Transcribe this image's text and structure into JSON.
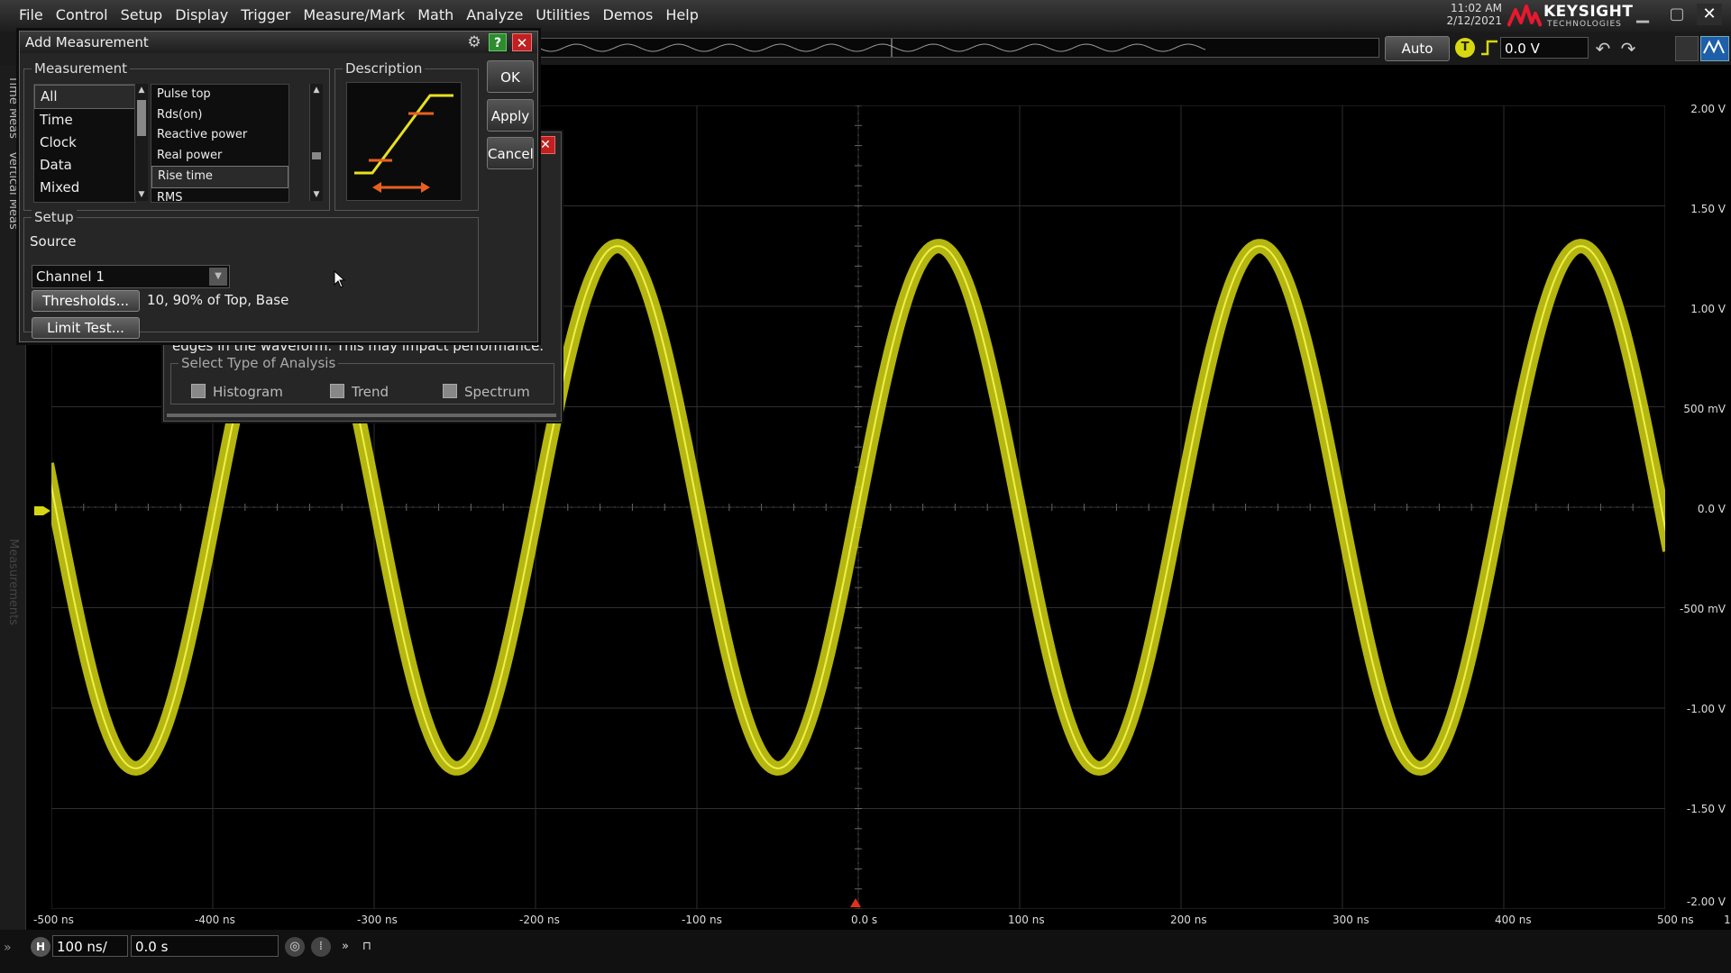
{
  "menu": {
    "items": [
      "File",
      "Control",
      "Setup",
      "Display",
      "Trigger",
      "Measure/Mark",
      "Math",
      "Analyze",
      "Utilities",
      "Demos",
      "Help"
    ]
  },
  "clock": {
    "time": "11:02 AM",
    "date": "2/12/2021"
  },
  "brand": {
    "name": "KEYSIGHT",
    "sub": "TECHNOLOGIES",
    "color": "#e8182e"
  },
  "toolbar": {
    "auto_label": "Auto",
    "trigger_badge": "T",
    "trigger_level": "0.0 V"
  },
  "sidebar": {
    "tab1": "Time Meas",
    "tab2": "Vertical Meas",
    "tab3": "Measurements"
  },
  "axes": {
    "y_labels": [
      "2.00 V",
      "1.50 V",
      "1.00 V",
      "500 mV",
      "0.0 V",
      "-500 mV",
      "-1.00 V",
      "-1.50 V",
      "-2.00 V"
    ],
    "x_labels": [
      "-500 ns",
      "-400 ns",
      "-300 ns",
      "-200 ns",
      "-100 ns",
      "0.0 s",
      "100 ns",
      "200 ns",
      "300 ns",
      "400 ns",
      "500 ns"
    ],
    "x_end_marker": "1",
    "trace_color": "#d6d614"
  },
  "horizontal": {
    "badge": "H",
    "scale": "100 ns/",
    "position": "0.0 s"
  },
  "analysis_dialog": {
    "close": "✕",
    "note": "edges in the waveform. This may impact performance.",
    "group_label": "Select Type of Analysis",
    "options": [
      "Histogram",
      "Trend",
      "Spectrum"
    ]
  },
  "dialog": {
    "title": "Add Measurement",
    "help": "?",
    "close": "✕",
    "measurement_label": "Measurement",
    "categories": [
      "All",
      "Time",
      "Clock",
      "Data",
      "Mixed"
    ],
    "selected_category": "All",
    "measurements": [
      "Pulse top",
      "Rds(on)",
      "Reactive power",
      "Real power",
      "Rise time",
      "RMS"
    ],
    "selected_measurement": "Rise time",
    "description_label": "Description",
    "buttons": {
      "ok": "OK",
      "apply": "Apply",
      "cancel": "Cancel"
    },
    "setup_label": "Setup",
    "source_label": "Source",
    "source_value": "Channel 1",
    "thresholds_button": "Thresholds...",
    "thresholds_text": "10, 90% of Top, Base",
    "limit_test_button": "Limit Test..."
  }
}
